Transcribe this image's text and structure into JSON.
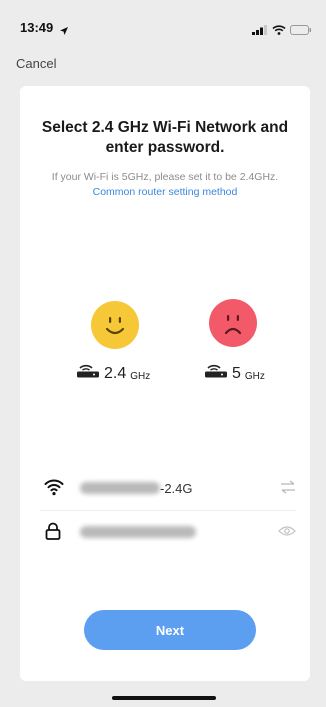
{
  "status_bar": {
    "time": "13:49"
  },
  "nav": {
    "cancel_label": "Cancel"
  },
  "card": {
    "title": "Select 2.4 GHz Wi-Fi Network and enter password.",
    "hint_text": "If your Wi-Fi is 5GHz, please set it to be 2.4GHz.",
    "hint_link": "Common router setting method"
  },
  "bands": [
    {
      "value": "2.4",
      "unit": "GHz",
      "status": "supported",
      "face_color": "#f6c737"
    },
    {
      "value": "5",
      "unit": "GHz",
      "status": "not-supported",
      "face_color": "#f25a6a"
    }
  ],
  "form": {
    "ssid_suffix": "-2.4G"
  },
  "actions": {
    "next_label": "Next"
  },
  "colors": {
    "accent": "#5c9ef0",
    "link": "#3b87e0"
  }
}
